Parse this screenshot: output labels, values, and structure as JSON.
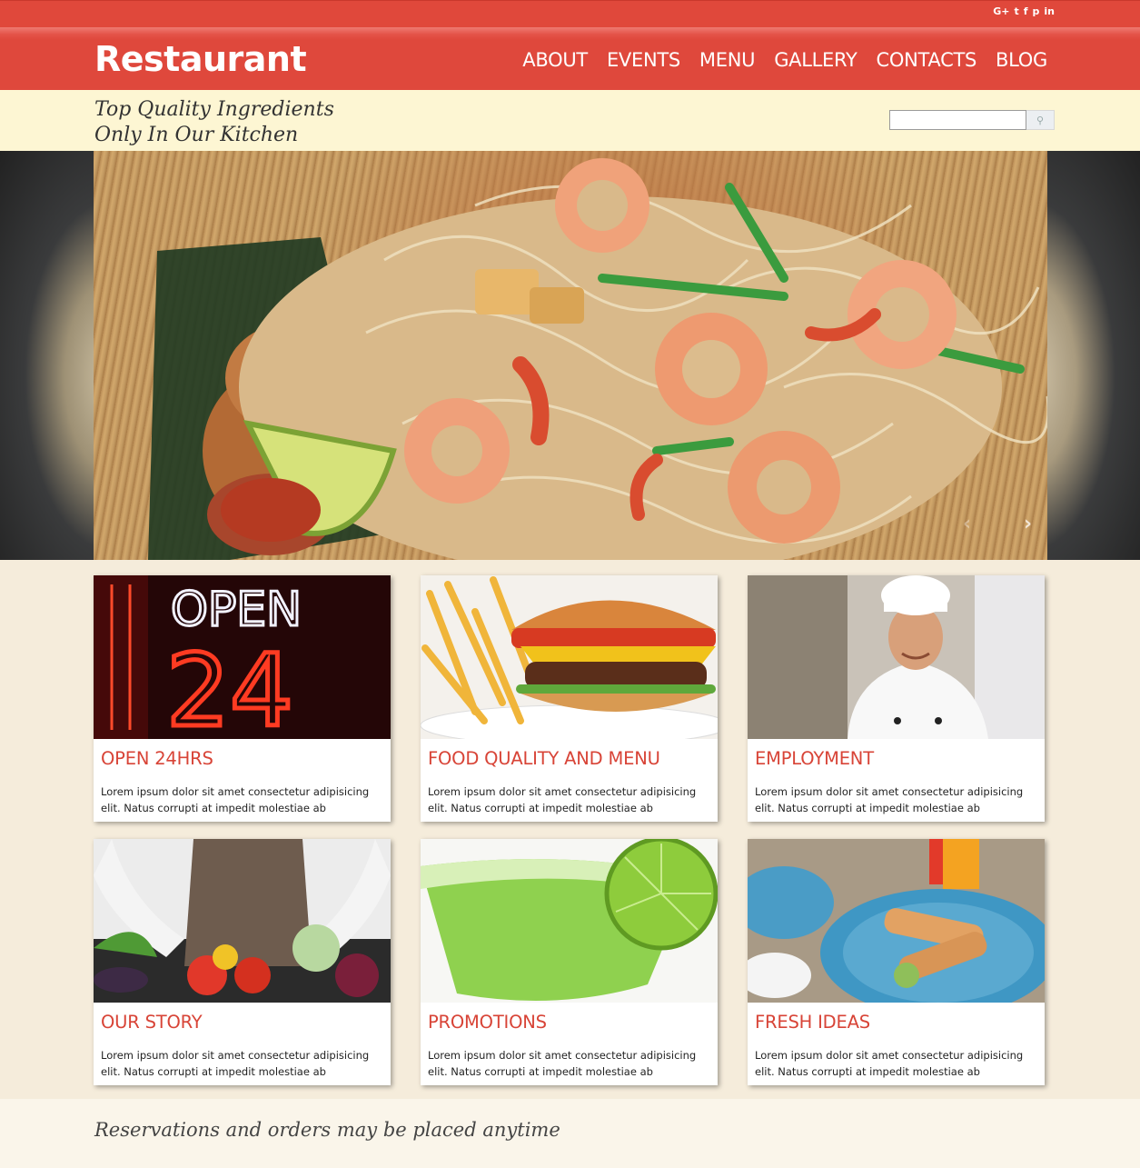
{
  "topbar": {
    "social": [
      {
        "icon": "google-plus-icon",
        "glyph": "G+"
      },
      {
        "icon": "twitter-icon",
        "glyph": "t"
      },
      {
        "icon": "facebook-icon",
        "glyph": "f"
      },
      {
        "icon": "pinterest-icon",
        "glyph": "p"
      },
      {
        "icon": "linkedin-icon",
        "glyph": "in"
      }
    ]
  },
  "header": {
    "brand": "Restaurant",
    "nav": [
      "ABOUT",
      "EVENTS",
      "MENU",
      "GALLERY",
      "CONTACTS",
      "BLOG"
    ]
  },
  "tagline": {
    "line1": "Top Quality Ingredients",
    "line2": "Only In Our Kitchen"
  },
  "search": {
    "placeholder": "",
    "button_icon": "search-icon"
  },
  "slider": {
    "prev_icon": "chevron-left-icon",
    "next_icon": "chevron-right-icon"
  },
  "cards": [
    {
      "title": "OPEN 24HRS",
      "text": "Lorem ipsum dolor sit amet consectetur adipisicing elit. Natus corrupti at impedit molestiae ab",
      "image": "open-24-neon-sign"
    },
    {
      "title": "FOOD QUALITY AND MENU",
      "text": "Lorem ipsum dolor sit amet consectetur adipisicing elit. Natus corrupti at impedit molestiae ab",
      "image": "burger-and-fries"
    },
    {
      "title": "EMPLOYMENT",
      "text": "Lorem ipsum dolor sit amet consectetur adipisicing elit. Natus corrupti at impedit molestiae ab",
      "image": "smiling-chef"
    },
    {
      "title": "OUR STORY",
      "text": "Lorem ipsum dolor sit amet consectetur adipisicing elit. Natus corrupti at impedit molestiae ab",
      "image": "cook-with-vegetables"
    },
    {
      "title": "PROMOTIONS",
      "text": "Lorem ipsum dolor sit amet consectetur adipisicing elit. Natus corrupti at impedit molestiae ab",
      "image": "lime-cocktail"
    },
    {
      "title": "FRESH IDEAS",
      "text": "Lorem ipsum dolor sit amet consectetur adipisicing elit. Natus corrupti at impedit molestiae ab",
      "image": "spring-rolls-plate"
    }
  ],
  "footer": {
    "text": "Reservations and orders may be placed anytime"
  },
  "colors": {
    "accent": "#df483c",
    "tagstrip": "#fdf6d3",
    "background": "#f5ecdb",
    "card_title": "#d84437"
  }
}
